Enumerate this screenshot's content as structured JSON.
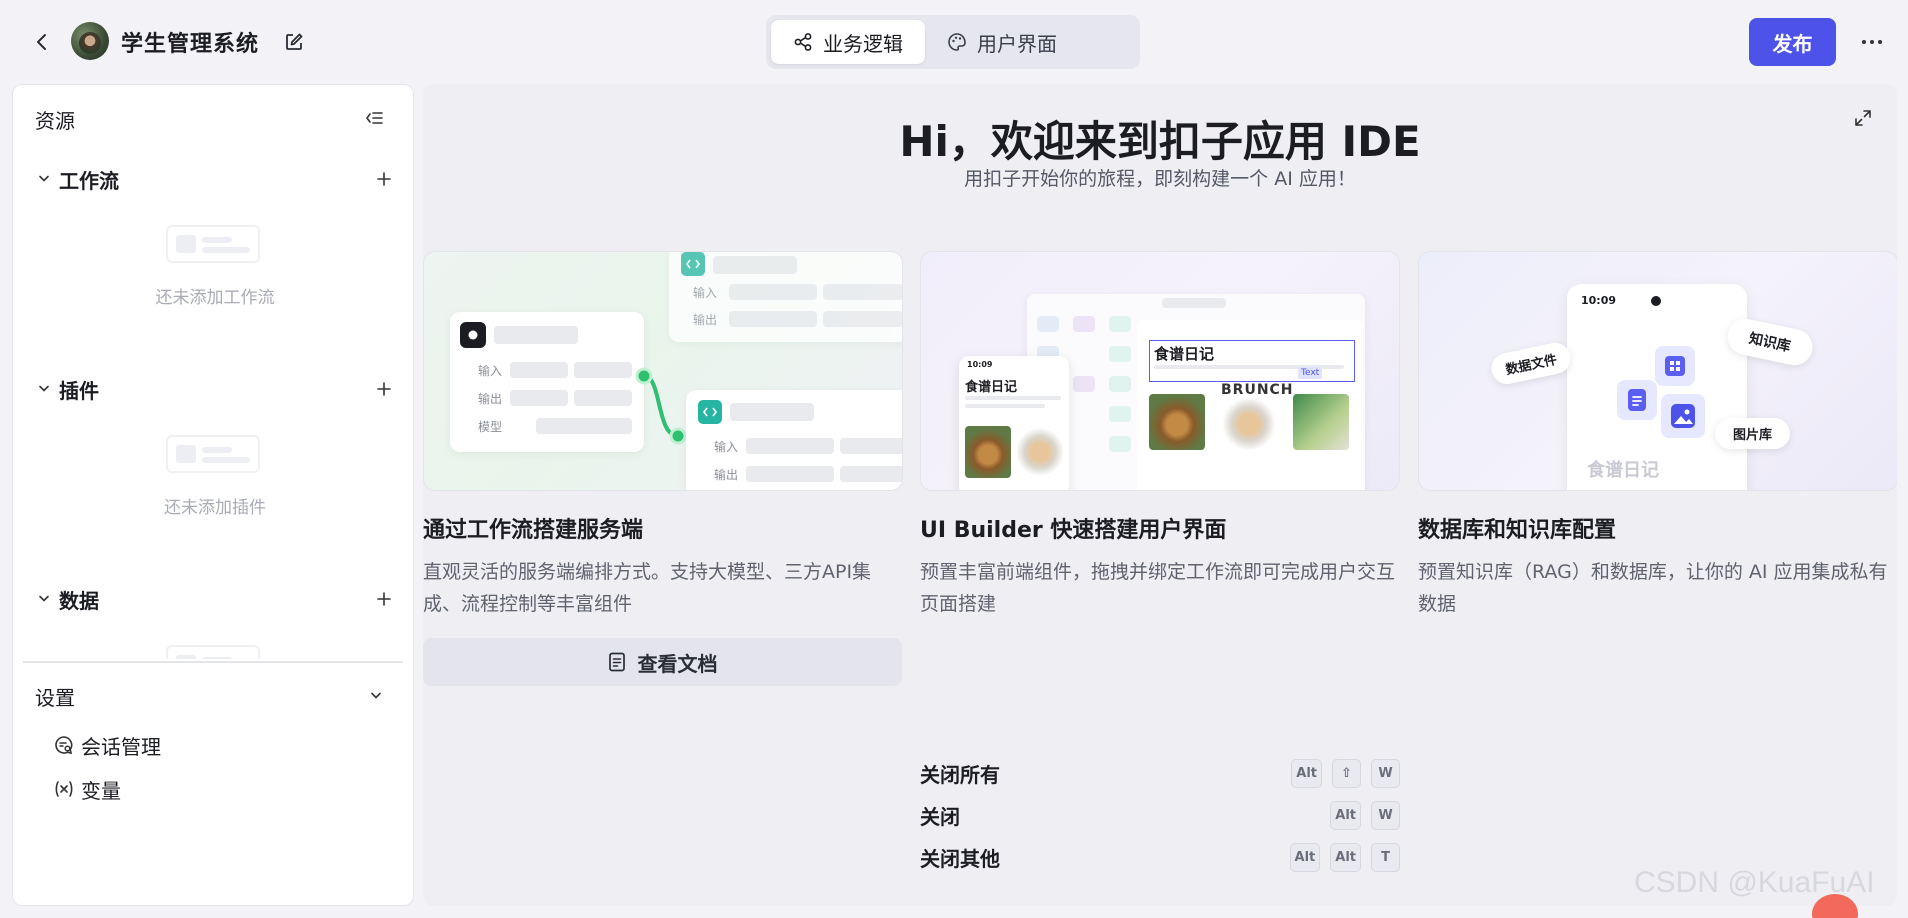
{
  "header": {
    "app_title": "学生管理系统",
    "tabs": [
      {
        "label": "业务逻辑",
        "icon": "flow-icon",
        "active": true
      },
      {
        "label": "用户界面",
        "icon": "palette-icon",
        "active": false
      }
    ],
    "publish_label": "发布",
    "more_label": "···"
  },
  "sidebar": {
    "title": "资源",
    "sections": [
      {
        "label": "工作流",
        "empty_text": "还未添加工作流"
      },
      {
        "label": "插件",
        "empty_text": "还未添加插件"
      },
      {
        "label": "数据",
        "empty_text": ""
      }
    ],
    "settings": {
      "title": "设置",
      "items": [
        {
          "label": "会话管理",
          "icon": "chat-settings-icon"
        },
        {
          "label": "变量",
          "icon": "variable-icon"
        }
      ]
    }
  },
  "main": {
    "welcome_title": "Hi，欢迎来到扣子应用 IDE",
    "welcome_subtitle": "用扣子开始你的旅程，即刻构建一个 AI 应用！",
    "cards": [
      {
        "title": "通过工作流搭建服务端",
        "desc": "直观灵活的服务端编排方式。支持大模型、三方API集成、流程控制等丰富组件",
        "illustration": {
          "in_label": "输入",
          "out_label": "输出",
          "model_label": "模型"
        }
      },
      {
        "title": "UI Builder 快速搭建用户界面",
        "desc": "预置丰富前端组件，拖拽并绑定工作流即可完成用户交互页面搭建",
        "illustration": {
          "recipe_title": "食谱日记",
          "text_tag": "Text",
          "brunch": "BRUNCH",
          "time": "10:09"
        }
      },
      {
        "title": "数据库和知识库配置",
        "desc": "预置知识库（RAG）和数据库，让你的 AI 应用集成私有数据",
        "illustration": {
          "time": "10:09",
          "tag_file": "数据文件",
          "tag_kb": "知识库",
          "tag_img": "图片库",
          "recipe_title": "食谱日记"
        }
      }
    ],
    "doc_button_label": "查看文档",
    "shortcuts": [
      {
        "label": "关闭所有",
        "keys": [
          "Alt",
          "⇧",
          "W"
        ]
      },
      {
        "label": "关闭",
        "keys": [
          "Alt",
          "W"
        ]
      },
      {
        "label": "关闭其他",
        "keys": [
          "Alt",
          "Alt",
          "T"
        ]
      }
    ]
  },
  "watermark": "CSDN @KuaFuAI"
}
